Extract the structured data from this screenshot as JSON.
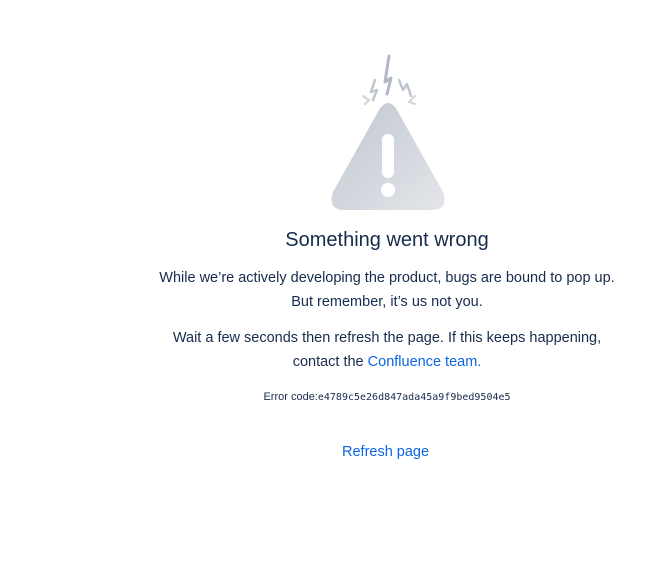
{
  "error_page": {
    "title": "Something went wrong",
    "paragraph_1_line_1": "While we’re actively developing the product, bugs are bound to pop up.",
    "paragraph_1_line_2": "But remember, it’s us not you.",
    "paragraph_2_line_1": "Wait a few seconds then refresh the page. If this keeps happening,",
    "paragraph_2_prefix": "contact the ",
    "contact_link": "Confluence team.",
    "error_code_label": "Error code:",
    "error_code": "e4789c5e26d847ada45a9f9bed9504e5",
    "refresh_label": "Refresh page",
    "illustration_icon": "warning-triangle-icon"
  }
}
